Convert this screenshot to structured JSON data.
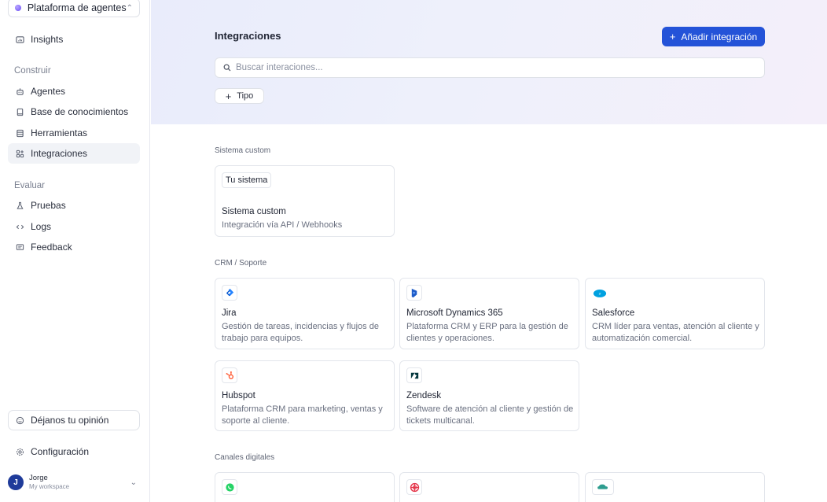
{
  "sidebar": {
    "workspace": "Plataforma de agentes",
    "insights": "Insights",
    "build_label": "Construir",
    "build_items": {
      "agents": "Agentes",
      "knowledge": "Base de conocimientos",
      "tools": "Herramientas",
      "integrations": "Integraciones"
    },
    "evaluate_label": "Evaluar",
    "evaluate_items": {
      "tests": "Pruebas",
      "logs": "Logs",
      "feedback": "Feedback"
    },
    "opinion_button": "Déjanos tu opinión",
    "settings": "Configuración",
    "user": {
      "initial": "J",
      "name": "Jorge",
      "workspace": "My workspace"
    }
  },
  "header": {
    "title": "Integraciones",
    "add_button": "Añadir integración",
    "search_placeholder": "Buscar interaciones...",
    "type_button": "Tipo"
  },
  "groups": {
    "custom": {
      "label": "Sistema custom",
      "card": {
        "chip": "Tu sistema",
        "title": "Sistema custom",
        "desc": "Integración vía API / Webhooks"
      }
    },
    "crm": {
      "label": "CRM / Soporte",
      "cards": [
        {
          "title": "Jira",
          "desc": "Gestión de tareas, incidencias y flujos de trabajo para equipos.",
          "icon": "jira-icon"
        },
        {
          "title": "Microsoft Dynamics 365",
          "desc": "Plataforma CRM y ERP para la gestión de clientes y operaciones.",
          "icon": "dynamics-icon"
        },
        {
          "title": "Salesforce",
          "desc": "CRM líder para ventas, atención al cliente y automatización comercial.",
          "icon": "salesforce-icon"
        },
        {
          "title": "Hubspot",
          "desc": "Plataforma CRM para marketing, ventas y soporte al cliente.",
          "icon": "hubspot-icon"
        },
        {
          "title": "Zendesk",
          "desc": "Software de atención al cliente y gestión de tickets multicanal.",
          "icon": "zendesk-icon"
        }
      ]
    },
    "digital": {
      "label": "Canales digitales"
    }
  },
  "colors": {
    "accent": "#2453d8",
    "avatar": "#1f3b9a"
  }
}
